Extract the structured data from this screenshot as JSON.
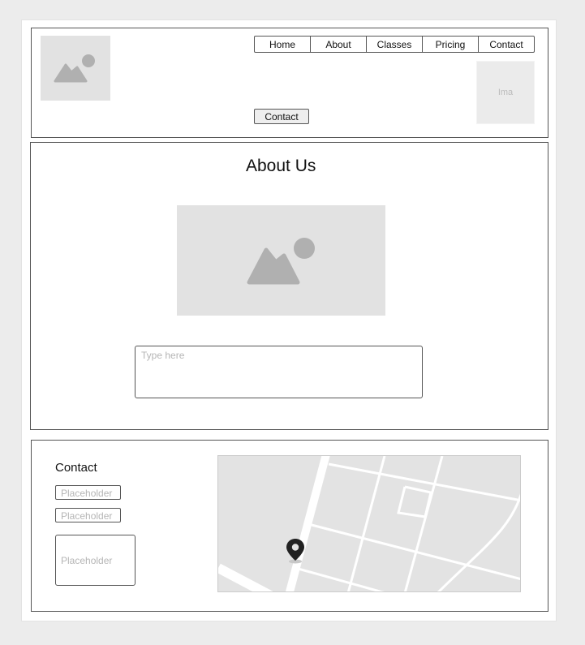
{
  "header": {
    "logo": "image-placeholder-icon",
    "nav": [
      "Home",
      "About",
      "Classes",
      "Pricing",
      "Contact"
    ],
    "contact_button": "Contact",
    "side_image_label": "Ima"
  },
  "about": {
    "title": "About Us",
    "image": "image-placeholder-icon",
    "textarea_placeholder": "Type here"
  },
  "contact": {
    "title": "Contact",
    "field1_placeholder": "Placeholder",
    "field2_placeholder": "Placeholder",
    "message_placeholder": "Placeholder",
    "map": "map-placeholder",
    "marker": "map-pin-icon"
  },
  "colors": {
    "placeholder_bg": "#e2e2e2",
    "placeholder_icon": "#b0b0b0",
    "border": "#555555"
  }
}
